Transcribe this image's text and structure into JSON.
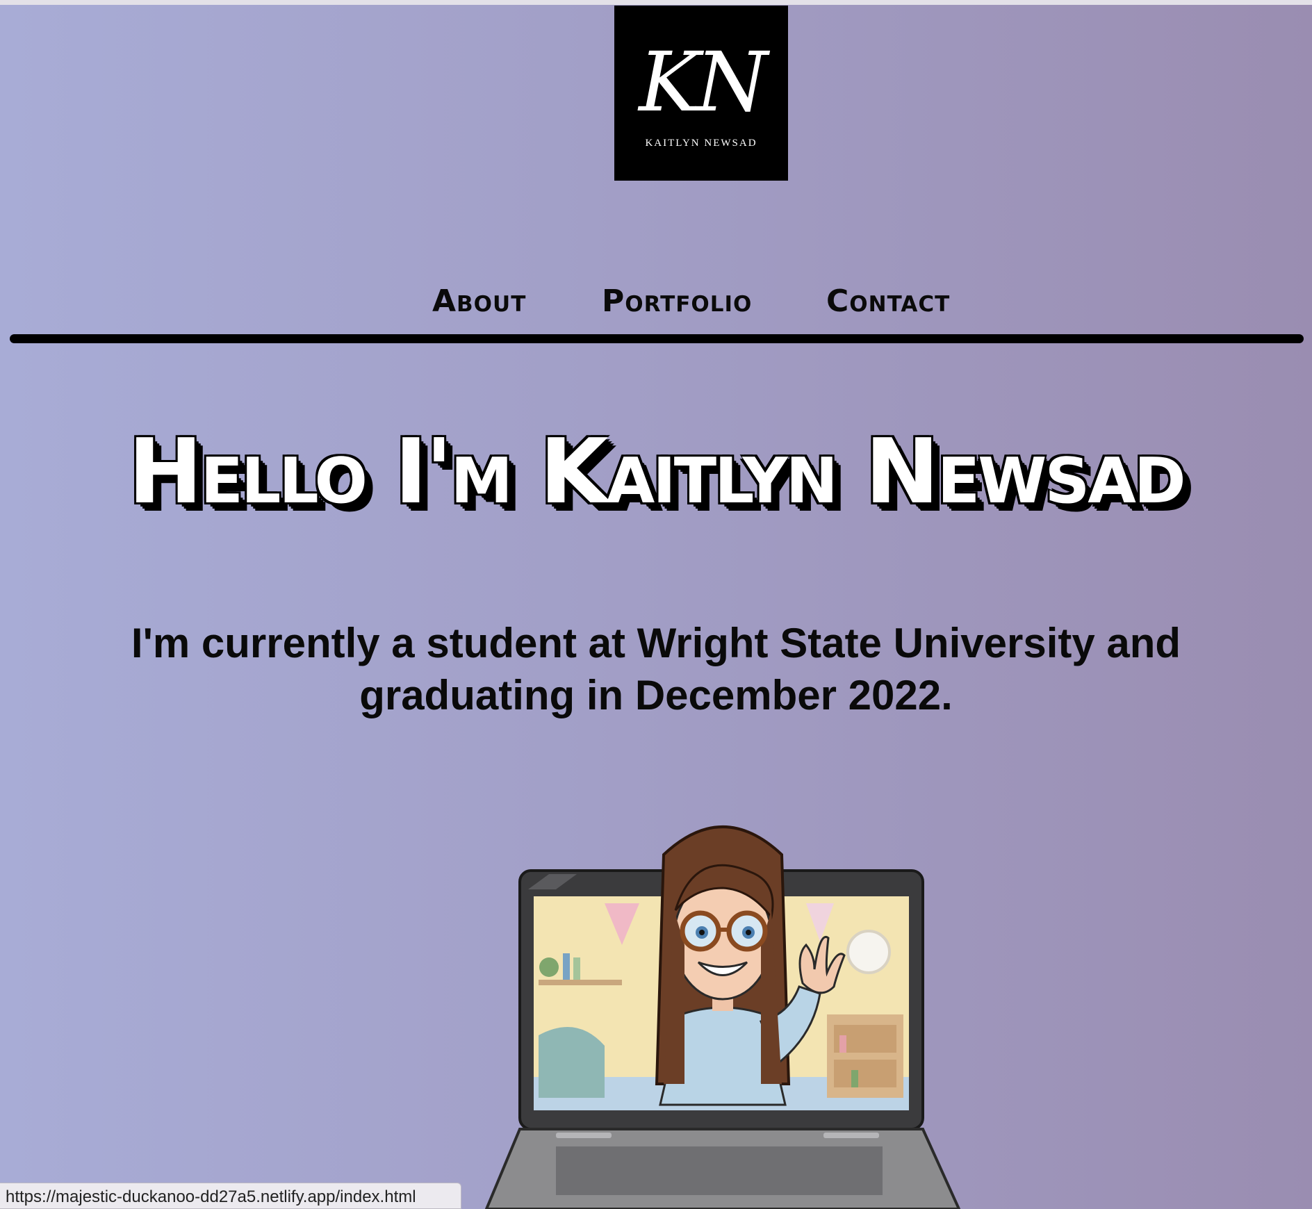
{
  "logo": {
    "monogram": "KN",
    "name": "KAITLYN NEWSAD"
  },
  "nav": {
    "about": "About",
    "portfolio": "Portfolio",
    "contact": "Contact"
  },
  "hero": {
    "headline": "Hello I'm Kaitlyn Newsad",
    "intro_line1": "I'm currently a student at Wright State University and",
    "intro_line2": "graduating in December 2022."
  },
  "status_bar": {
    "url": "https://majestic-duckanoo-dd27a5.netlify.app/index.html"
  },
  "colors": {
    "accent_black": "#000000",
    "background_left": "#a8acd6",
    "background_right": "#9a8db1"
  }
}
